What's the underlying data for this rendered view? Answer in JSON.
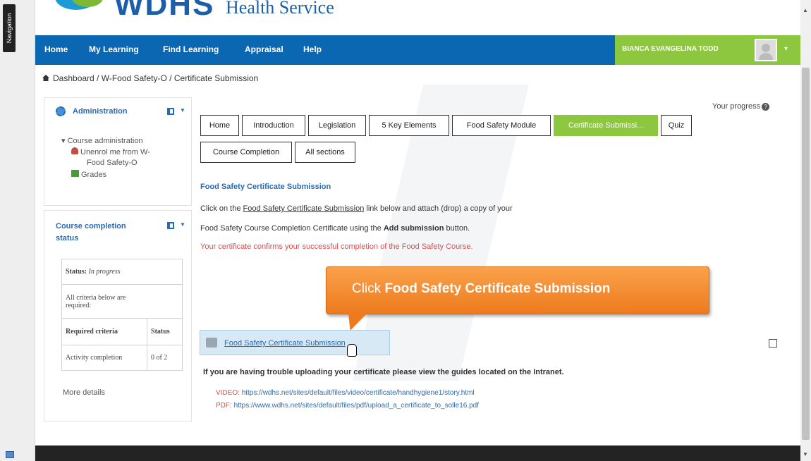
{
  "nav_strip": {
    "label": "Navigation"
  },
  "logo": {
    "letters": "WDHS",
    "subtitle": "Health Service"
  },
  "topnav": {
    "items": [
      "Home",
      "My Learning",
      "Find Learning",
      "Appraisal",
      "Help"
    ],
    "user_name": "BIANCA EVANGELINA TODD",
    "user_caret": "▾"
  },
  "breadcrumb": {
    "text": "Dashboard / W-Food Safety-O / Certificate Submission"
  },
  "admin_block": {
    "title": "Administration",
    "course_admin": "Course administration",
    "unenrol_line1": "Unenrol me from W-",
    "unenrol_line2": "Food Safety-O",
    "grades": "Grades"
  },
  "completion_block": {
    "title_line1": "Course completion",
    "title_line2": "status",
    "status_label": "Status:",
    "status_value": "In progress",
    "criteria_note_line1": "All criteria below are",
    "criteria_note_line2": "required:",
    "col_required": "Required criteria",
    "col_status": "Status",
    "row_label": "Activity completion",
    "row_value": "0 of 2",
    "more_details": "More details"
  },
  "progress": {
    "label": "Your progress",
    "help": "?"
  },
  "tabs": {
    "row1": [
      "Home",
      "Introduction",
      "Legislation",
      "5 Key Elements",
      "Food Safety Module",
      "Certificate Submissi...",
      "Quiz"
    ],
    "row2": [
      "Course Completion",
      "All sections"
    ]
  },
  "content": {
    "section_title": "Food Safety Certificate Submission",
    "para1_pre": "Click on the ",
    "para1_link": "Food Safety Certificate Submission",
    "para1_post": " link below and attach (drop) a copy of your",
    "para2_pre": "Food Safety Course Completion Certificate using the ",
    "para2_bold": "Add submission",
    "para2_post": " button.",
    "red_note": "Your certificate confirms your successful completion of the Food Safety Course."
  },
  "callout": {
    "prefix": "Click ",
    "bold": "Food Safety Certificate Submission"
  },
  "activity": {
    "label": "Food Safety Certificate Submission"
  },
  "trouble": {
    "text": "If you are having trouble uploading your certificate please view the guides located on the Intranet."
  },
  "links": {
    "video_label": "VIDEO:",
    "video_url": "https://wdhs.net/sites/default/files/video/certificate/handhygiene1/story.html",
    "pdf_label": "PDF:",
    "pdf_url": "https://www.wdhs.net/sites/default/files/pdf/upload_a_certificate_to_solle16.pdf"
  },
  "scrollbar": {
    "up": "▲",
    "down": "▼"
  }
}
